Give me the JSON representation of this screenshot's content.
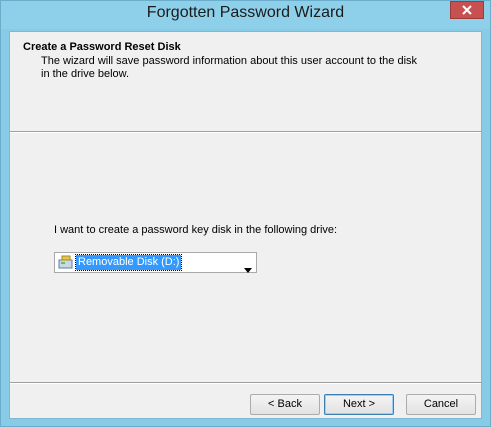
{
  "window": {
    "title": "Forgotten Password Wizard"
  },
  "header": {
    "title": "Create a Password Reset Disk",
    "description": "The wizard will save password information about this user account to the disk in the drive below."
  },
  "main": {
    "prompt": "I want to create a password key disk in the following drive:",
    "drive_select": {
      "selected": "Removable Disk (D:)",
      "icon": "removable-disk-icon"
    }
  },
  "buttons": {
    "back": "< Back",
    "next": "Next >",
    "cancel": "Cancel"
  },
  "colors": {
    "title_bar": "#8ed0ea",
    "close_button": "#c75050",
    "selection": "#3399ff"
  }
}
